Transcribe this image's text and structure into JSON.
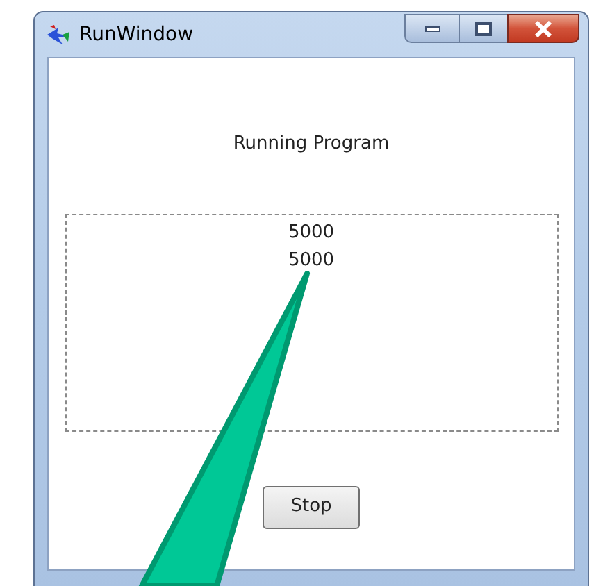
{
  "window": {
    "title": "RunWindow"
  },
  "heading": "Running Program",
  "output_lines": [
    "5000",
    "5000"
  ],
  "stop_button": {
    "label": "Stop"
  }
}
